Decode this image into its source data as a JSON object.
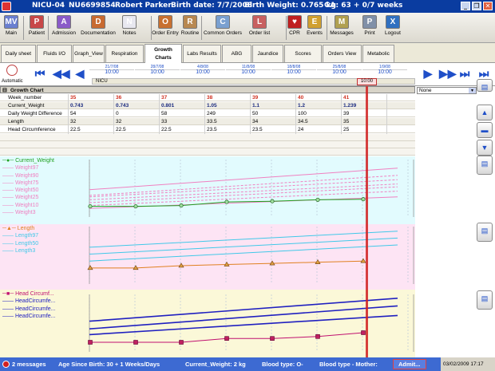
{
  "titlebar": {
    "unit": "NICU-04",
    "mrn": "NU6699854",
    "patient_name": "Robert Parker",
    "birth_date": "Birth date: 7/7/2008",
    "birth_weight": "Birth Weight: 0.765 kg",
    "ga": "GA: 63 + 0/7 weeks",
    "minimize": "_",
    "restore": "❐",
    "close": "✕"
  },
  "toolbar": [
    {
      "label": "Main",
      "icon": "MV",
      "color": "#6a7fd0"
    },
    {
      "label": "Patient",
      "icon": "P",
      "color": "#c84848"
    },
    {
      "label": "Admission",
      "icon": "A",
      "color": "#8a5ac8"
    },
    {
      "label": "Documentation",
      "icon": "D",
      "color": "#c86a30"
    },
    {
      "label": "Notes",
      "icon": "N",
      "color": "#e8e8f0"
    },
    {
      "label": "Order Entry",
      "icon": "O",
      "color": "#c87030"
    },
    {
      "label": "Routine",
      "icon": "R",
      "color": "#b88850"
    },
    {
      "label": "Common Orders",
      "icon": "C",
      "color": "#7aa0d0"
    },
    {
      "label": "Order list",
      "icon": "L",
      "color": "#c86060"
    },
    {
      "label": "CPR",
      "icon": "♥",
      "color": "#c02020"
    },
    {
      "label": "Events",
      "icon": "E",
      "color": "#d0a030"
    },
    {
      "label": "Messages",
      "icon": "M",
      "color": "#b0a050"
    },
    {
      "label": "Print",
      "icon": "P",
      "color": "#8090a8"
    },
    {
      "label": "Logout",
      "icon": "X",
      "color": "#3070c0"
    }
  ],
  "tabs": [
    "Daily sheet",
    "Fluids I/O",
    "Graph_View",
    "Respiration",
    "Growth Charts",
    "Labs Results",
    "ABG",
    "Jaundice",
    "Scores",
    "Orders View",
    "Metabolic"
  ],
  "active_tab": "Growth Charts",
  "nav": {
    "mode": "Automatic",
    "unit_label": "NICU",
    "times": [
      {
        "date": "21/7/08",
        "time": "10:00"
      },
      {
        "date": "28/7/08",
        "time": "10:00"
      },
      {
        "date": "4/8/08",
        "time": "10:00"
      },
      {
        "date": "11/8/08",
        "time": "10:00"
      },
      {
        "date": "18/8/08",
        "time": "10:00"
      },
      {
        "date": "25/8/08",
        "time": "10:00"
      },
      {
        "date": "1/9/08",
        "time": "10:00"
      }
    ],
    "current_marker": "10:00"
  },
  "growth_table": {
    "title": "Growth Chart",
    "select_value": "None",
    "rows": [
      {
        "label": "Week_number",
        "values": [
          "35",
          "36",
          "37",
          "38",
          "39",
          "40",
          "41"
        ],
        "color": "#d03020"
      },
      {
        "label": "Current_Weight",
        "values": [
          "0.743",
          "0.743",
          "0.801",
          "1.05",
          "1.1",
          "1.2",
          "1.239"
        ],
        "color": "#1a2a80"
      },
      {
        "label": "Daily Weight Difference",
        "values": [
          "54",
          "0",
          "58",
          "249",
          "50",
          "100",
          "39"
        ],
        "color": "#000"
      },
      {
        "label": "Length",
        "values": [
          "32",
          "32",
          "33",
          "33.5",
          "34",
          "34.5",
          "35"
        ],
        "color": "#000"
      },
      {
        "label": "Head Circumference",
        "values": [
          "22.5",
          "22.5",
          "22.5",
          "23.5",
          "23.5",
          "24",
          "25"
        ],
        "color": "#000"
      }
    ]
  },
  "chart_data": [
    {
      "type": "line",
      "ylim": [
        0,
        4
      ],
      "yticks": [
        "0",
        "1",
        "2",
        "3",
        "4"
      ],
      "series": [
        {
          "name": "Current_Weight",
          "color": "#20a020",
          "x": [
            35,
            36,
            37,
            38,
            39,
            40,
            41
          ],
          "values": [
            0.743,
            0.743,
            0.801,
            1.05,
            1.1,
            1.2,
            1.239
          ]
        },
        {
          "name": "Weight97",
          "color": "#f080c0",
          "values": [
            1.9,
            3.4
          ]
        },
        {
          "name": "Weight90",
          "color": "#f080c0",
          "values": [
            1.5,
            2.9
          ]
        },
        {
          "name": "Weight75",
          "color": "#f080c0",
          "values": [
            1.4,
            2.6
          ]
        },
        {
          "name": "Weight50",
          "color": "#f080c0",
          "values": [
            1.2,
            2.3
          ]
        },
        {
          "name": "Weight25",
          "color": "#f080c0",
          "values": [
            1.0,
            2.1
          ]
        },
        {
          "name": "Weight10",
          "color": "#f080c0",
          "values": [
            0.8,
            1.8
          ]
        },
        {
          "name": "Weight3",
          "color": "#f080c0",
          "values": [
            0.6,
            1.4
          ]
        }
      ]
    },
    {
      "type": "line",
      "ylim": [
        25,
        50
      ],
      "yticks": [
        "25",
        "30",
        "35",
        "40",
        "45",
        "50"
      ],
      "series": [
        {
          "name": "Length",
          "color": "#e08020",
          "x": [
            35,
            36,
            37,
            38,
            39,
            40,
            41
          ],
          "values": [
            32,
            32,
            33,
            33.5,
            34,
            34.5,
            35
          ]
        },
        {
          "name": "Length97",
          "color": "#40c8e8",
          "values": [
            41,
            48
          ]
        },
        {
          "name": "Length50",
          "color": "#40c8e8",
          "values": [
            38,
            45
          ]
        },
        {
          "name": "Length3",
          "color": "#40c8e8",
          "values": [
            35,
            42
          ]
        }
      ]
    },
    {
      "type": "line",
      "ylim": [
        20,
        35
      ],
      "yticks": [
        "20",
        "25",
        "30",
        "35"
      ],
      "series": [
        {
          "name": "Head Circumf...",
          "color": "#c01070",
          "x": [
            35,
            36,
            37,
            38,
            39,
            40,
            41
          ],
          "values": [
            22.5,
            22.5,
            22.5,
            23.5,
            23.5,
            24,
            25
          ]
        },
        {
          "name": "HeadCircumfe...",
          "color": "#2020c0",
          "values": [
            28,
            34
          ]
        },
        {
          "name": "HeadCircumfe...",
          "color": "#2020c0",
          "values": [
            26,
            32
          ]
        },
        {
          "name": "HeadCircumfe...",
          "color": "#2020c0",
          "values": [
            24.5,
            29.5
          ]
        }
      ]
    }
  ],
  "status": {
    "messages": "2 messages",
    "age": "Age Since Birth: 30 + 1 Weeks/Days",
    "weight": "Current_Weight: 2 kg",
    "blood_type": "Blood type: O-",
    "blood_type_mother": "Blood type - Mother:",
    "admit": "Admit...",
    "datetime": "03/02/2009 17:17"
  }
}
